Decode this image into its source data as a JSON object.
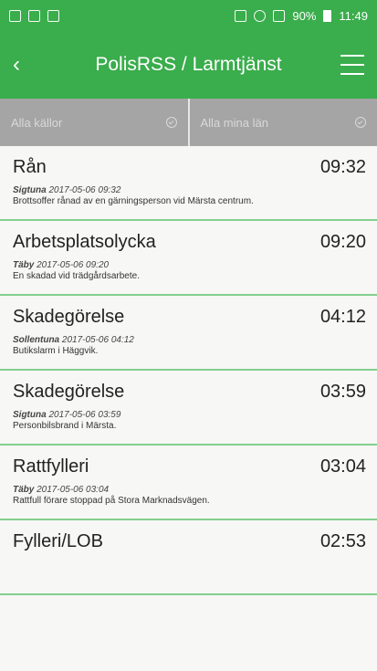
{
  "status": {
    "battery_text": "90%",
    "time": "11:49"
  },
  "appbar": {
    "title": "PolisRSS / Larmtjänst"
  },
  "filters": [
    {
      "label": "Alla källor"
    },
    {
      "label": "Alla mina län"
    }
  ],
  "items": [
    {
      "title": "Rån",
      "time": "09:32",
      "location": "Sigtuna",
      "datetime": "2017-05-06 09:32",
      "description": "Brottsoffer rånad av en gärningsperson vid Märsta centrum."
    },
    {
      "title": "Arbetsplatsolycka",
      "time": "09:20",
      "location": "Täby",
      "datetime": "2017-05-06 09:20",
      "description": "En skadad vid trädgårdsarbete."
    },
    {
      "title": "Skadegörelse",
      "time": "04:12",
      "location": "Sollentuna",
      "datetime": "2017-05-06 04:12",
      "description": "Butikslarm i Häggvik."
    },
    {
      "title": "Skadegörelse",
      "time": "03:59",
      "location": "Sigtuna",
      "datetime": "2017-05-06 03:59",
      "description": "Personbilsbrand i Märsta."
    },
    {
      "title": "Rattfylleri",
      "time": "03:04",
      "location": "Täby",
      "datetime": "2017-05-06 03:04",
      "description": "Rattfull förare stoppad på Stora Marknadsvägen."
    },
    {
      "title": "Fylleri/LOB",
      "time": "02:53",
      "location": "",
      "datetime": "",
      "description": ""
    }
  ]
}
